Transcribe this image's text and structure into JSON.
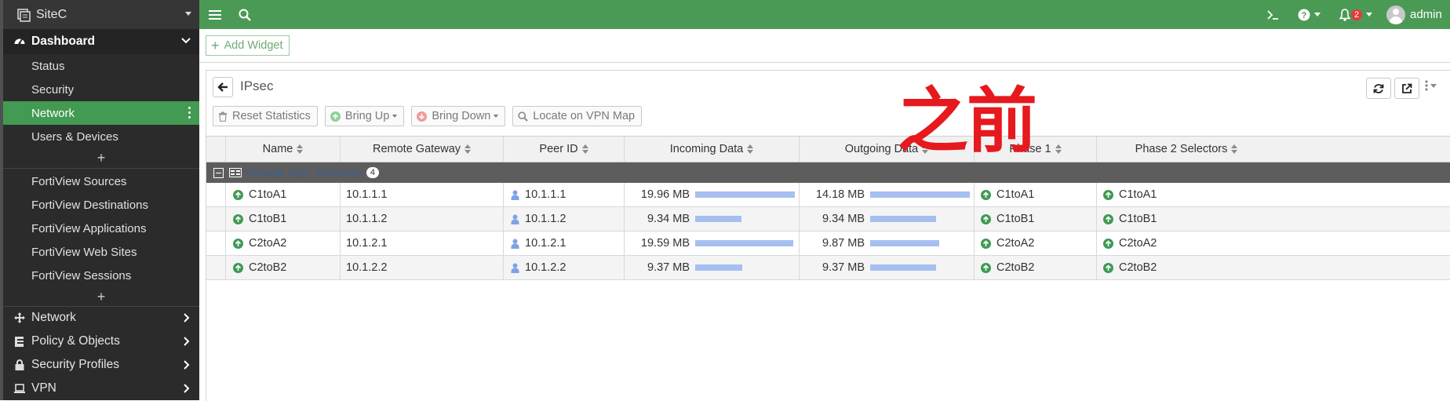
{
  "sidebar": {
    "site_name": "SiteC",
    "dashboard_label": "Dashboard",
    "dashboard_items": [
      {
        "label": "Status"
      },
      {
        "label": "Security"
      },
      {
        "label": "Network",
        "active": true
      },
      {
        "label": "Users & Devices"
      }
    ],
    "plus_symbol": "+",
    "fortiview_items": [
      {
        "label": "FortiView Sources"
      },
      {
        "label": "FortiView Destinations"
      },
      {
        "label": "FortiView Applications"
      },
      {
        "label": "FortiView Web Sites"
      },
      {
        "label": "FortiView Sessions"
      }
    ],
    "main_nav": [
      {
        "label": "Network",
        "icon": "network-icon"
      },
      {
        "label": "Policy & Objects",
        "icon": "policy-icon"
      },
      {
        "label": "Security Profiles",
        "icon": "lock-icon"
      },
      {
        "label": "VPN",
        "icon": "laptop-icon"
      }
    ]
  },
  "topbar": {
    "notification_count": "2",
    "user_name": "admin",
    "color": "#4a9a56"
  },
  "widget_bar": {
    "add_widget_label": "Add Widget"
  },
  "panel": {
    "title": "IPsec",
    "overlay_text": "之前",
    "toolbar": {
      "reset": "Reset Statistics",
      "bring_up": "Bring Up",
      "bring_down": "Bring Down",
      "locate": "Locate on VPN Map"
    }
  },
  "table": {
    "columns": [
      "Name",
      "Remote Gateway",
      "Peer ID",
      "Incoming Data",
      "Outgoing Data",
      "Phase 1",
      "Phase 2 Selectors"
    ],
    "group": {
      "label": "Remote Site - FortiGate",
      "count": "4"
    },
    "rows": [
      {
        "name": "C1toA1",
        "gateway": "10.1.1.1",
        "peer": "10.1.1.1",
        "incoming": "19.96 MB",
        "outgoing": "14.18 MB",
        "phase1": "C1toA1",
        "phase2": "C1toA1",
        "in_level": 1.0,
        "out_level": 1.0
      },
      {
        "name": "C1toB1",
        "gateway": "10.1.1.2",
        "peer": "10.1.1.2",
        "incoming": "9.34 MB",
        "outgoing": "9.34 MB",
        "phase1": "C1toB1",
        "phase2": "C1toB1",
        "in_level": 0.468,
        "out_level": 0.659
      },
      {
        "name": "C2toA2",
        "gateway": "10.1.2.1",
        "peer": "10.1.2.1",
        "incoming": "19.59 MB",
        "outgoing": "9.87 MB",
        "phase1": "C2toA2",
        "phase2": "C2toA2",
        "in_level": 0.981,
        "out_level": 0.696
      },
      {
        "name": "C2toB2",
        "gateway": "10.1.2.2",
        "peer": "10.1.2.2",
        "incoming": "9.37 MB",
        "outgoing": "9.37 MB",
        "phase1": "C2toB2",
        "phase2": "C2toB2",
        "in_level": 0.469,
        "out_level": 0.661
      }
    ]
  }
}
